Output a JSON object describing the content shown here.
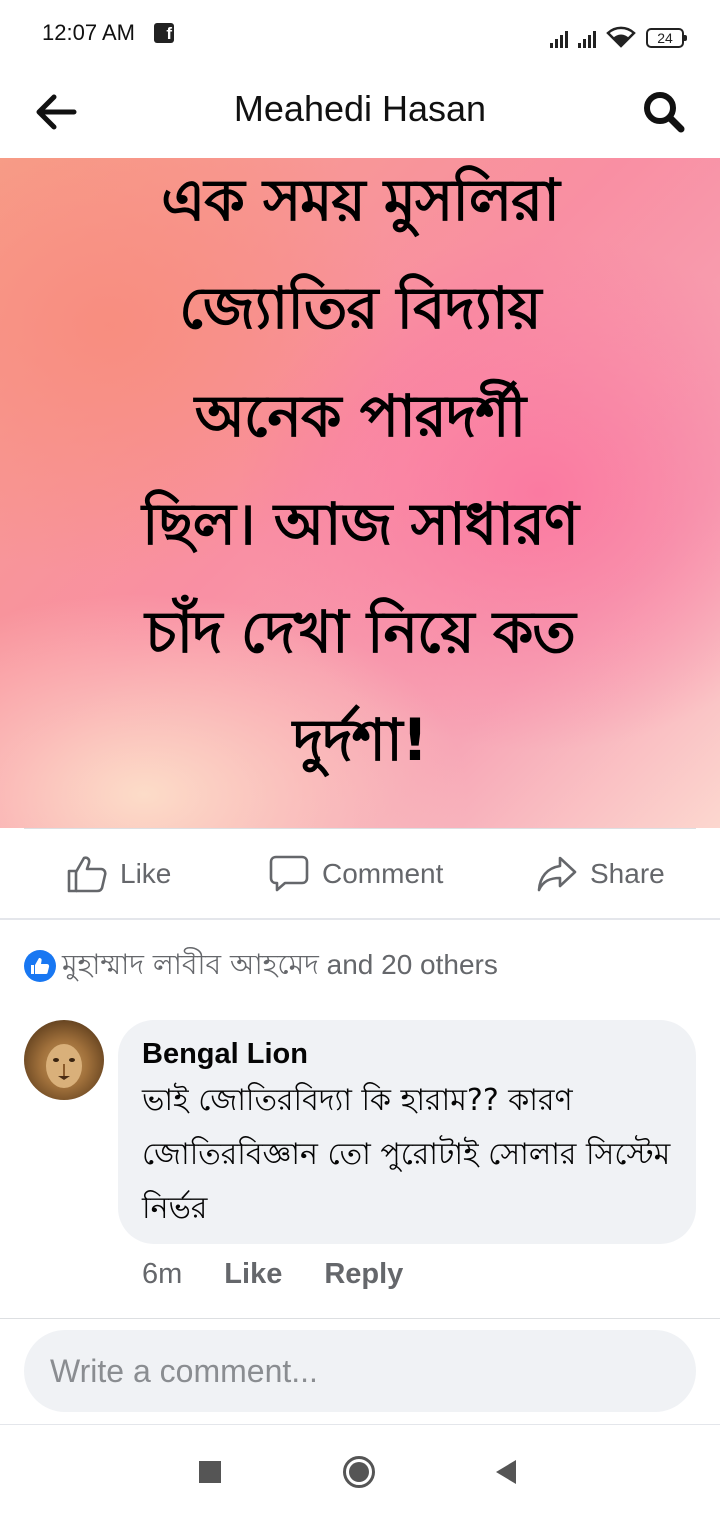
{
  "status_bar": {
    "time": "12:07 AM",
    "battery": "24"
  },
  "header": {
    "title": "Meahedi Hasan",
    "back_icon": "arrow-left-icon",
    "search_icon": "search-icon"
  },
  "post": {
    "text_lines": [
      "এক সময় মুসলিরা",
      "জ্যোতির বিদ্যায়",
      "অনেক পারদর্শী",
      "ছিল। আজ সাধারণ",
      "চাঁদ দেখা নিয়ে কত",
      "দুর্দশা!"
    ]
  },
  "actions": {
    "like": "Like",
    "comment": "Comment",
    "share": "Share"
  },
  "reactions": {
    "names": "মুহাম্মাদ লাবীব আহমেদ",
    "others": " and 20 others"
  },
  "comment": {
    "author": "Bengal Lion",
    "text": "ভাই জোতিরবিদ্যা কি হারাম?? কারণ জোতিরবিজ্ঞান তো পুরোটাই সোলার সিস্টেম নির্ভর",
    "time": "6m",
    "like": "Like",
    "reply": "Reply"
  },
  "composer": {
    "placeholder": "Write a comment..."
  },
  "colors": {
    "accent": "#1877f2",
    "secondary_text": "#65676b",
    "bubble": "#f0f2f5"
  }
}
